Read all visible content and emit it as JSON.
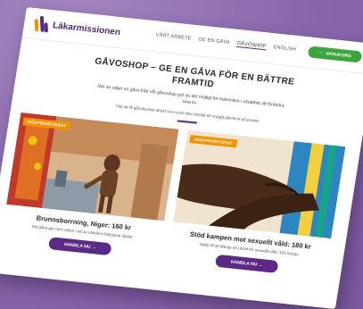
{
  "brand": {
    "name": "Läkarmissionen"
  },
  "nav": {
    "items": [
      {
        "label": "VÅRT ARBETE",
        "active": false
      },
      {
        "label": "GE EN GÅVA",
        "active": false
      },
      {
        "label": "GÅVOSHOP",
        "active": true
      },
      {
        "label": "ENGLISH",
        "active": false
      }
    ],
    "cart_label": "VARUKORG"
  },
  "hero": {
    "title": "GÅVOSHOP – GE EN GÅVA FÖR EN BÄTTRE FRAMTID",
    "intro": "När du väljer en gåva från vår gåvoshop gör du det möjligt för människor i utsatthet att förändra sina liv.",
    "hint": "Välj att få gåvobeviset direkt via e-post eller beställ ett snyggt gåvokort på posten."
  },
  "products": [
    {
      "badge": "HÖGPRIORITERAT",
      "title": "Brunnsborrning, Niger: 160 kr",
      "description": "Din gåva ger rent vatten i ett av världens fattigaste länder",
      "button": "HANDLA NU →"
    },
    {
      "badge": "HÖGPRIORITERAT",
      "title": "Stöd kampen mot sexuellt våld: 180 kr",
      "description": "Hjälp till att återge ett utsatt för sexuellt våld i DR Kongo",
      "button": "HANDLA NU →"
    }
  ],
  "colors": {
    "brand_purple": "#5b2a86",
    "badge_orange": "#f39200",
    "cart_green": "#3aa53a",
    "background": "#8a68ad"
  }
}
